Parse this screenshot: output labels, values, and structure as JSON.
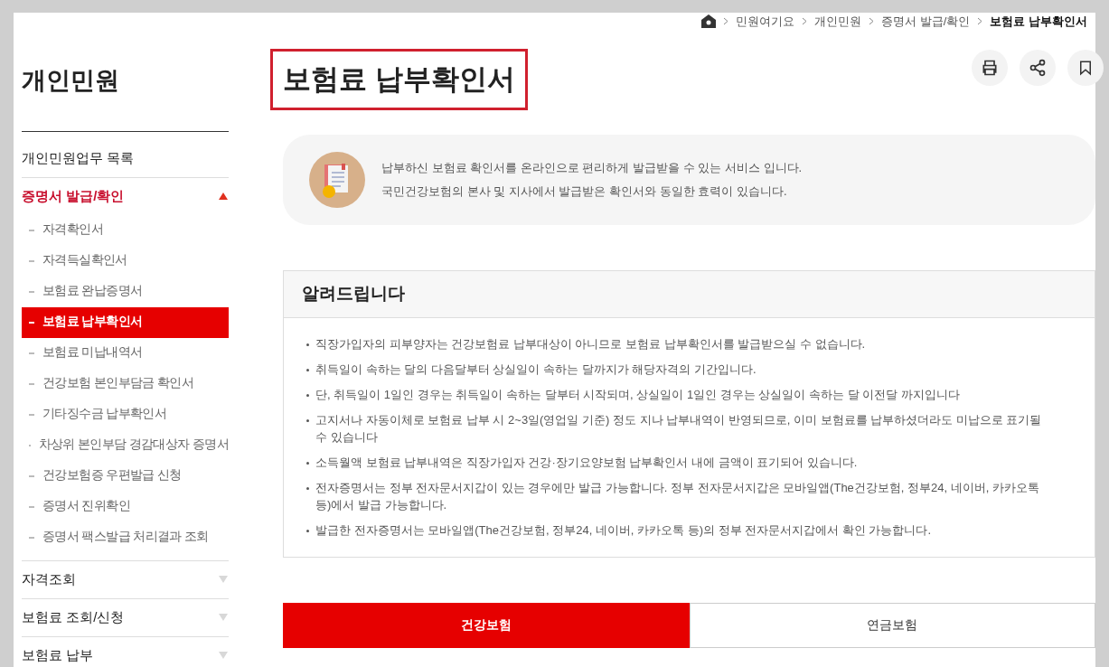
{
  "breadcrumb": [
    "민원여기요",
    "개인민원",
    "증명서 발급/확인",
    "보험료 납부확인서"
  ],
  "sidebar": {
    "title": "개인민원",
    "items": [
      {
        "label": "개인민원업무 목록",
        "kind": "link"
      },
      {
        "label": "증명서 발급/확인",
        "kind": "group",
        "expanded": true,
        "children": [
          {
            "label": "자격확인서",
            "selected": false
          },
          {
            "label": "자격득실확인서",
            "selected": false
          },
          {
            "label": "보험료 완납증명서",
            "selected": false
          },
          {
            "label": "보험료 납부확인서",
            "selected": true
          },
          {
            "label": "보험료 미납내역서",
            "selected": false
          },
          {
            "label": "건강보험 본인부담금 확인서",
            "selected": false
          },
          {
            "label": "기타징수금 납부확인서",
            "selected": false
          },
          {
            "label": "차상위 본인부담 경감대상자 증명서",
            "selected": false
          },
          {
            "label": "건강보험증 우편발급 신청",
            "selected": false
          },
          {
            "label": "증명서 진위확인",
            "selected": false
          },
          {
            "label": "증명서 팩스발급 처리결과 조회",
            "selected": false
          }
        ]
      },
      {
        "label": "자격조회",
        "kind": "group",
        "expanded": false
      },
      {
        "label": "보험료 조회/신청",
        "kind": "group",
        "expanded": false
      },
      {
        "label": "보험료 납부",
        "kind": "group",
        "expanded": false
      }
    ]
  },
  "page_title": {
    "text": "보험료 납부확인서",
    "highlighted": true
  },
  "intro": [
    "납부하신 보험료 확인서를 온라인으로 편리하게 발급받을 수 있는 서비스 입니다.",
    "국민건강보험의 본사 및 지사에서 발급받은 확인서와 동일한 효력이 있습니다."
  ],
  "notice": {
    "title": "알려드립니다",
    "items": [
      "직장가입자의 피부양자는 건강보험료 납부대상이 아니므로 보험료 납부확인서를 발급받으실 수 없습니다.",
      "취득일이 속하는 달의 다음달부터 상실일이 속하는 달까지가 해당자격의 기간입니다.",
      "단, 취득일이 1일인 경우는 취득일이 속하는 달부터 시작되며, 상실일이 1일인 경우는 상실일이 속하는 달 이전달 까지입니다",
      "고지서나 자동이체로 보험료 납부 시 2~3일(영업일 기준) 정도 지나 납부내역이 반영되므로, 이미 보험료를 납부하셨더라도 미납으로 표기될 수 있습니다",
      "소득월액 보험료 납부내역은 직장가입자 건강·장기요양보험 납부확인서 내에 금액이 표기되어 있습니다.",
      "전자증명서는 정부 전자문서지갑이 있는 경우에만 발급 가능합니다. 정부 전자문서지갑은 모바일앱(The건강보험, 정부24, 네이버, 카카오톡 등)에서 발급 가능합니다.",
      "발급한 전자증명서는 모바일앱(The건강보험, 정부24, 네이버, 카카오톡 등)의 정부 전자문서지갑에서 확인 가능합니다."
    ]
  },
  "tabs": [
    {
      "label": "건강보험",
      "selected": true
    },
    {
      "label": "연금보험",
      "selected": false
    }
  ]
}
